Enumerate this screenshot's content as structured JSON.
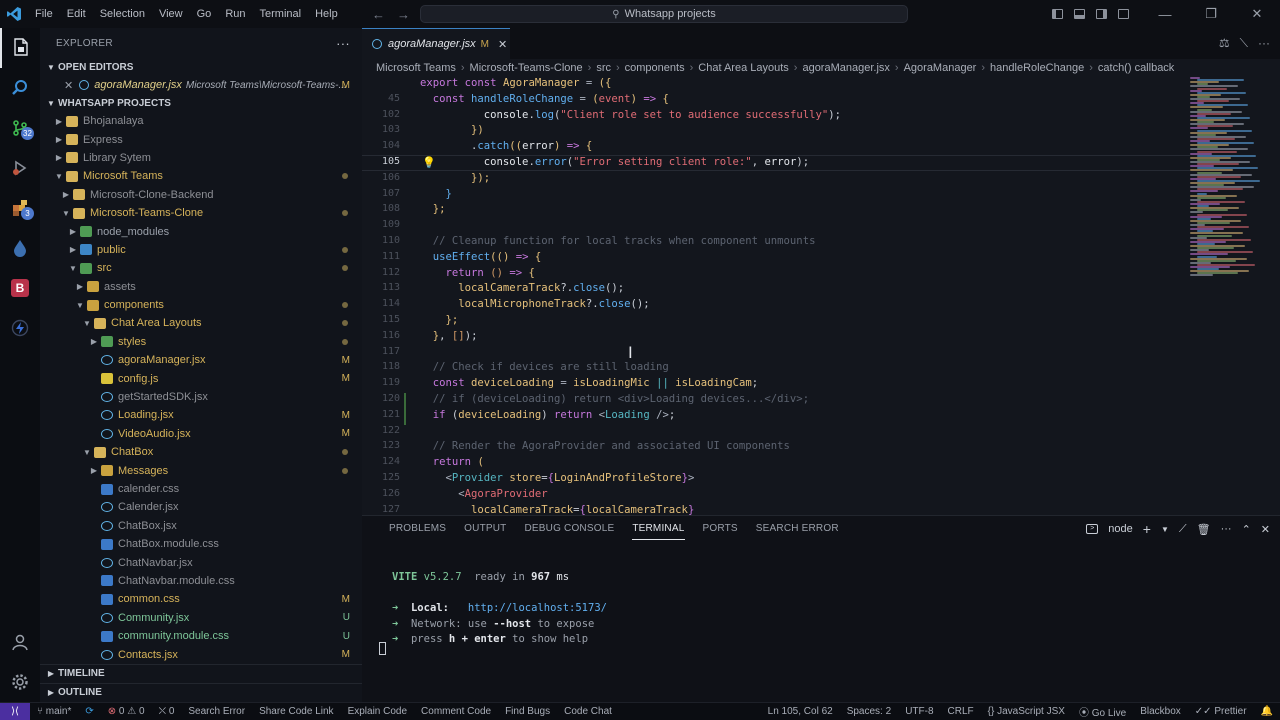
{
  "titlebar": {
    "menu": [
      "File",
      "Edit",
      "Selection",
      "View",
      "Go",
      "Run",
      "Terminal",
      "Help"
    ],
    "search_text": "Whatsapp projects"
  },
  "activity": {
    "badges": [
      "32",
      "3"
    ]
  },
  "sidebar": {
    "header": "EXPLORER",
    "open_editors_label": "OPEN EDITORS",
    "open_editor": {
      "name": "agoraManager.jsx",
      "path": "Microsoft Teams\\Microsoft-Teams-...",
      "status": "M"
    },
    "workspace_label": "WHATSAPP PROJECTS",
    "tree": [
      {
        "label": "Bhojanalaya",
        "depth": 0,
        "kind": "folder",
        "expanded": false,
        "color": "#8d8f95",
        "status": "",
        "dot": false
      },
      {
        "label": "Express",
        "depth": 0,
        "kind": "folder",
        "expanded": false,
        "color": "#8d8f95",
        "status": "",
        "dot": false
      },
      {
        "label": "Library Sytem",
        "depth": 0,
        "kind": "folder",
        "expanded": false,
        "color": "#8d8f95",
        "status": "",
        "dot": false
      },
      {
        "label": "Microsoft Teams",
        "depth": 0,
        "kind": "folder",
        "expanded": true,
        "color": "#d6b35a",
        "status": "",
        "dot": true
      },
      {
        "label": "Microsoft-Clone-Backend",
        "depth": 1,
        "kind": "folder",
        "expanded": false,
        "color": "#8d8f95",
        "status": "",
        "dot": false
      },
      {
        "label": "Microsoft-Teams-Clone",
        "depth": 1,
        "kind": "folder",
        "expanded": true,
        "color": "#d6b35a",
        "status": "",
        "dot": true
      },
      {
        "label": "node_modules",
        "depth": 2,
        "kind": "folder-green",
        "expanded": false,
        "color": "#9aa0aa",
        "status": "",
        "dot": false
      },
      {
        "label": "public",
        "depth": 2,
        "kind": "folder-blue",
        "expanded": false,
        "color": "#d6b35a",
        "status": "",
        "dot": true
      },
      {
        "label": "src",
        "depth": 2,
        "kind": "folder-green",
        "expanded": true,
        "color": "#d6b35a",
        "status": "",
        "dot": true
      },
      {
        "label": "assets",
        "depth": 3,
        "kind": "folder-yellow",
        "expanded": false,
        "color": "#8d8f95",
        "status": "",
        "dot": false
      },
      {
        "label": "components",
        "depth": 3,
        "kind": "folder-yellow",
        "expanded": true,
        "color": "#d6b35a",
        "status": "",
        "dot": true
      },
      {
        "label": "Chat Area Layouts",
        "depth": 4,
        "kind": "folder",
        "expanded": true,
        "color": "#d6b35a",
        "status": "",
        "dot": true
      },
      {
        "label": "styles",
        "depth": 5,
        "kind": "folder-green",
        "expanded": false,
        "color": "#d6b35a",
        "status": "",
        "dot": true
      },
      {
        "label": "agoraManager.jsx",
        "depth": 5,
        "kind": "react",
        "color": "#d6b35a",
        "status": "M",
        "dot": false
      },
      {
        "label": "config.js",
        "depth": 5,
        "kind": "js",
        "color": "#d6b35a",
        "status": "M",
        "dot": false
      },
      {
        "label": "getStartedSDK.jsx",
        "depth": 5,
        "kind": "react",
        "color": "#8d8f95",
        "status": "",
        "dot": false
      },
      {
        "label": "Loading.jsx",
        "depth": 5,
        "kind": "react",
        "color": "#d6b35a",
        "status": "M",
        "dot": false
      },
      {
        "label": "VideoAudio.jsx",
        "depth": 5,
        "kind": "react",
        "color": "#d6b35a",
        "status": "M",
        "dot": false
      },
      {
        "label": "ChatBox",
        "depth": 4,
        "kind": "folder",
        "expanded": true,
        "color": "#d6b35a",
        "status": "",
        "dot": true
      },
      {
        "label": "Messages",
        "depth": 5,
        "kind": "folder-yellow",
        "expanded": false,
        "color": "#d6b35a",
        "status": "",
        "dot": true
      },
      {
        "label": "calender.css",
        "depth": 5,
        "kind": "css",
        "color": "#8d8f95",
        "status": "",
        "dot": false
      },
      {
        "label": "Calender.jsx",
        "depth": 5,
        "kind": "react",
        "color": "#8d8f95",
        "status": "",
        "dot": false
      },
      {
        "label": "ChatBox.jsx",
        "depth": 5,
        "kind": "react",
        "color": "#8d8f95",
        "status": "",
        "dot": false
      },
      {
        "label": "ChatBox.module.css",
        "depth": 5,
        "kind": "css",
        "color": "#8d8f95",
        "status": "",
        "dot": false
      },
      {
        "label": "ChatNavbar.jsx",
        "depth": 5,
        "kind": "react",
        "color": "#8d8f95",
        "status": "",
        "dot": false
      },
      {
        "label": "ChatNavbar.module.css",
        "depth": 5,
        "kind": "css",
        "color": "#8d8f95",
        "status": "",
        "dot": false
      },
      {
        "label": "common.css",
        "depth": 5,
        "kind": "css",
        "color": "#d6b35a",
        "status": "M",
        "dot": false
      },
      {
        "label": "Community.jsx",
        "depth": 5,
        "kind": "react",
        "color": "#7ec699",
        "status": "U",
        "dot": false
      },
      {
        "label": "community.module.css",
        "depth": 5,
        "kind": "css",
        "color": "#7ec699",
        "status": "U",
        "dot": false
      },
      {
        "label": "Contacts.jsx",
        "depth": 5,
        "kind": "react",
        "color": "#d6b35a",
        "status": "M",
        "dot": false
      }
    ],
    "timeline_label": "TIMELINE",
    "outline_label": "OUTLINE"
  },
  "editor": {
    "tab": {
      "name": "agoraManager.jsx",
      "status": "M"
    },
    "breadcrumb": [
      "Microsoft Teams",
      "Microsoft-Teams-Clone",
      "src",
      "components",
      "Chat Area Layouts",
      "agoraManager.jsx",
      "AgoraManager",
      "handleRoleChange",
      "catch() callback"
    ],
    "active_line": "105",
    "lines": [
      {
        "n": "",
        "html": "<span class='k'>export</span> <span class='k'>const</span> <span class='v'>AgoraManager</span> <span class='p'>=</span> <span class='v'>({</span>"
      },
      {
        "n": "45",
        "html": "  <span class='k'>const</span> <span class='f'>handleRoleChange</span> <span class='p'>=</span> <span class='v'>(</span><span class='s'>event</span><span class='v'>)</span> <span class='k'>=&gt;</span> <span class='v'>{</span>"
      },
      {
        "n": "102",
        "html": "          <span class='w'>console</span>.<span class='f'>log</span>(<span class='s'>\"Client role set to audience successfully\"</span>);"
      },
      {
        "n": "103",
        "html": "        <span class='v'>})</span>"
      },
      {
        "n": "104",
        "html": "        .<span class='f'>catch</span><span class='v'>((</span><span class='w'>error</span><span class='v'>)</span> <span class='k'>=&gt;</span> <span class='v'>{</span>"
      },
      {
        "n": "105",
        "html": "          <span class='w'>console</span>.<span class='f'>error</span>(<span class='s'>\"Error setting client role:\"</span>, <span class='w'>error</span>);"
      },
      {
        "n": "106",
        "html": "        <span class='v'>});</span>"
      },
      {
        "n": "107",
        "html": "    <span class='f'>}</span>"
      },
      {
        "n": "108",
        "html": "  <span class='v'>};</span>"
      },
      {
        "n": "109",
        "html": ""
      },
      {
        "n": "110",
        "html": "  <span class='c'>// Cleanup function for local tracks when component unmounts</span>"
      },
      {
        "n": "111",
        "html": "  <span class='f'>useEffect</span><span class='v'>((</span><span class='v'>)</span> <span class='k'>=&gt;</span> <span class='v'>{</span>"
      },
      {
        "n": "112",
        "html": "    <span class='k'>return</span> <span class='n'>()</span> <span class='k'>=&gt;</span> <span class='v'>{</span>"
      },
      {
        "n": "113",
        "html": "      <span class='v'>localCameraTrack</span>?.<span class='f'>close</span>();"
      },
      {
        "n": "114",
        "html": "      <span class='v'>localMicrophoneTrack</span>?.<span class='f'>close</span>();"
      },
      {
        "n": "115",
        "html": "    <span class='v'>};</span>"
      },
      {
        "n": "116",
        "html": "  <span class='v'>}</span>, <span class='n'>[]</span>);"
      },
      {
        "n": "117",
        "html": ""
      },
      {
        "n": "118",
        "html": "  <span class='c'>// Check if devices are still loading</span>"
      },
      {
        "n": "119",
        "html": "  <span class='k'>const</span> <span class='v'>deviceLoading</span> <span class='p'>=</span> <span class='v'>isLoadingMic</span> <span class='t'>||</span> <span class='v'>isLoadingCam</span>;"
      },
      {
        "n": "120",
        "html": "  <span class='c'>// if (deviceLoading) return &lt;div&gt;Loading devices...&lt;/div&gt;;</span>"
      },
      {
        "n": "121",
        "html": "  <span class='k'>if</span> (<span class='v'>deviceLoading</span>) <span class='k'>return</span> <span class='p'>&lt;</span><span class='t'>Loading</span> <span class='p'>/&gt;</span>;"
      },
      {
        "n": "122",
        "html": ""
      },
      {
        "n": "123",
        "html": "  <span class='c'>// Render the AgoraProvider and associated UI components</span>"
      },
      {
        "n": "124",
        "html": "  <span class='k'>return</span> <span class='v'>(</span>"
      },
      {
        "n": "125",
        "html": "    <span class='p'>&lt;</span><span class='t'>Provider</span> <span class='v'>store</span>=<span class='k'>{</span><span class='v'>LoginAndProfileStore</span><span class='k'>}</span><span class='p'>&gt;</span>"
      },
      {
        "n": "126",
        "html": "      <span class='p'>&lt;</span><span class='s'>AgoraProvider</span>"
      },
      {
        "n": "127",
        "html": "        <span class='v'>localCameraTrack</span>=<span class='k'>{</span><span class='v'>localCameraTrack</span><span class='k'>}</span>"
      }
    ]
  },
  "panel": {
    "tabs": [
      "PROBLEMS",
      "OUTPUT",
      "DEBUG CONSOLE",
      "TERMINAL",
      "PORTS",
      "SEARCH ERROR"
    ],
    "active_tab": "TERMINAL",
    "shell_label": "node",
    "terminal": {
      "vite": "VITE",
      "version": "v5.2.7",
      "ready_text": "ready in",
      "ms": "967",
      "ms_unit": "ms",
      "local_label": "Local:",
      "local_url": "http://localhost:5173/",
      "network_label": "Network:",
      "network_use": "use",
      "network_flag": "--host",
      "network_tail": "to expose",
      "help_press": "press",
      "help_key": "h + enter",
      "help_tail": "to show help"
    }
  },
  "statusbar": {
    "branch": "main*",
    "errors": "0",
    "warnings": "0",
    "ports": "0",
    "left_items": [
      "Search Error",
      "Share Code Link",
      "Explain Code",
      "Comment Code",
      "Find Bugs",
      "Code Chat"
    ],
    "position": "Ln 105, Col 62",
    "spaces": "Spaces: 2",
    "encoding": "UTF-8",
    "eol": "CRLF",
    "language": "JavaScript JSX",
    "golive": "Go Live",
    "blackbox": "Blackbox",
    "prettier": "Prettier"
  }
}
